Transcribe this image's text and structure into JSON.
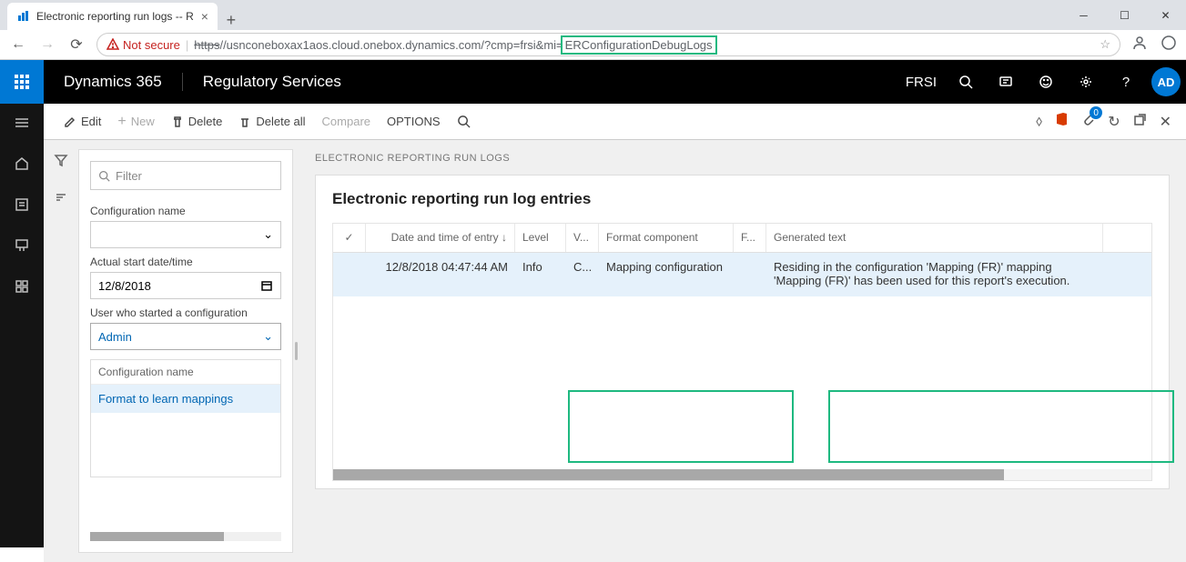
{
  "browser": {
    "tab_title": "Electronic reporting run logs -- R",
    "not_secure": "Not secure",
    "url_prefix_https": "https",
    "url_host": "//usnconeboxax1aos.cloud.onebox.dynamics.com/?cmp=frsi&mi=",
    "url_highlight": "ERConfigurationDebugLogs"
  },
  "header": {
    "brand": "Dynamics 365",
    "service": "Regulatory Services",
    "company": "FRSI",
    "avatar": "AD"
  },
  "actions": {
    "edit": "Edit",
    "new": "New",
    "delete": "Delete",
    "delete_all": "Delete all",
    "compare": "Compare",
    "options": "OPTIONS",
    "badge": "0"
  },
  "filters": {
    "filter_placeholder": "Filter",
    "config_name_label": "Configuration name",
    "config_name_value": "",
    "start_date_label": "Actual start date/time",
    "start_date_value": "12/8/2018",
    "user_label": "User who started a configuration",
    "user_value": "Admin",
    "list_header": "Configuration name",
    "list_item": "Format to learn mappings"
  },
  "page": {
    "label": "ELECTRONIC REPORTING RUN LOGS",
    "title": "Electronic reporting run log entries",
    "columns": {
      "date": "Date and time of entry",
      "level": "Level",
      "v": "V...",
      "component": "Format component",
      "f": "F...",
      "text": "Generated text"
    },
    "row": {
      "date": "12/8/2018 04:47:44 AM",
      "level": "Info",
      "v": "C...",
      "component": "Mapping configuration",
      "f": "",
      "text": "Residing in the configuration 'Mapping (FR)' mapping 'Mapping (FR)' has been used for this report's execution."
    }
  }
}
